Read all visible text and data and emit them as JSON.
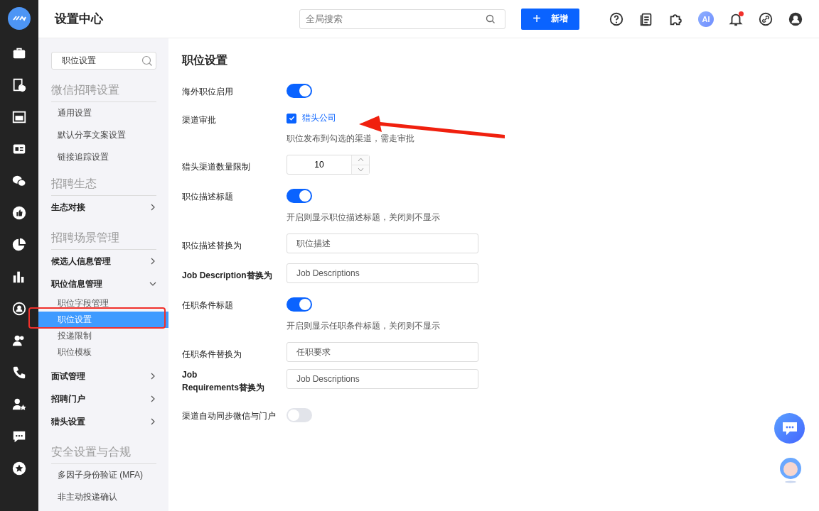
{
  "header": {
    "title": "设置中心",
    "search": {
      "placeholder": "全局搜索"
    },
    "add_button": {
      "icon": "+",
      "label": "新增"
    },
    "ai_badge": "AI",
    "has_notification": true
  },
  "sidebar": {
    "search": {
      "value": "职位设置"
    },
    "items": [
      {
        "kind": "heading",
        "label": "微信招聘设置"
      },
      {
        "kind": "link",
        "label": "通用设置",
        "selected": false
      },
      {
        "kind": "link",
        "label": "默认分享文案设置",
        "selected": false
      },
      {
        "kind": "link",
        "label": "链接追踪设置",
        "selected": false
      },
      {
        "kind": "heading",
        "label": "招聘生态"
      },
      {
        "kind": "menu",
        "label": "生态对接",
        "expanded": false
      },
      {
        "kind": "heading",
        "label": "招聘场景管理"
      },
      {
        "kind": "menu",
        "label": "候选人信息管理",
        "expanded": false
      },
      {
        "kind": "menu",
        "label": "职位信息管理",
        "expanded": true,
        "children": [
          {
            "label": "职位字段管理",
            "selected": false
          },
          {
            "label": "职位设置",
            "selected": true
          },
          {
            "label": "投递限制",
            "selected": false
          },
          {
            "label": "职位模板",
            "selected": false
          }
        ]
      },
      {
        "kind": "menu",
        "label": "面试管理",
        "expanded": false
      },
      {
        "kind": "menu",
        "label": "招聘门户",
        "expanded": false
      },
      {
        "kind": "menu",
        "label": "猎头设置",
        "expanded": false
      },
      {
        "kind": "heading",
        "label": "安全设置与合规"
      },
      {
        "kind": "link",
        "label": "多因子身份验证 (MFA)",
        "selected": false
      },
      {
        "kind": "link",
        "label": "非主动投递确认",
        "selected": false
      }
    ]
  },
  "page": {
    "title": "职位设置",
    "rows": [
      {
        "kind": "toggle",
        "label": "海外职位启用",
        "on": true
      },
      {
        "kind": "checkbox",
        "label": "渠道审批",
        "option": "猎头公司",
        "checked": true,
        "hint": "职位发布到勾选的渠道，需走审批"
      },
      {
        "kind": "number",
        "label": "猎头渠道数量限制",
        "value": "10"
      },
      {
        "kind": "toggle",
        "label": "职位描述标题",
        "on": true,
        "hint": "开启则显示职位描述标题，关闭则不显示"
      },
      {
        "kind": "input",
        "label": "职位描述替换为",
        "value": "职位描述"
      },
      {
        "kind": "input",
        "label": "Job Description替换为",
        "bold": true,
        "value": "Job Descriptions"
      },
      {
        "kind": "toggle",
        "label": "任职条件标题",
        "on": true,
        "hint": "开启则显示任职条件标题，关闭则不显示"
      },
      {
        "kind": "input",
        "label": "任职条件替换为",
        "value": "任职要求"
      },
      {
        "kind": "input",
        "label": "Job Requirements替换为",
        "bold": true,
        "wrap": true,
        "value": "Job Descriptions"
      },
      {
        "kind": "toggle",
        "label": "渠道自动同步微信与门户",
        "on": false
      }
    ]
  }
}
